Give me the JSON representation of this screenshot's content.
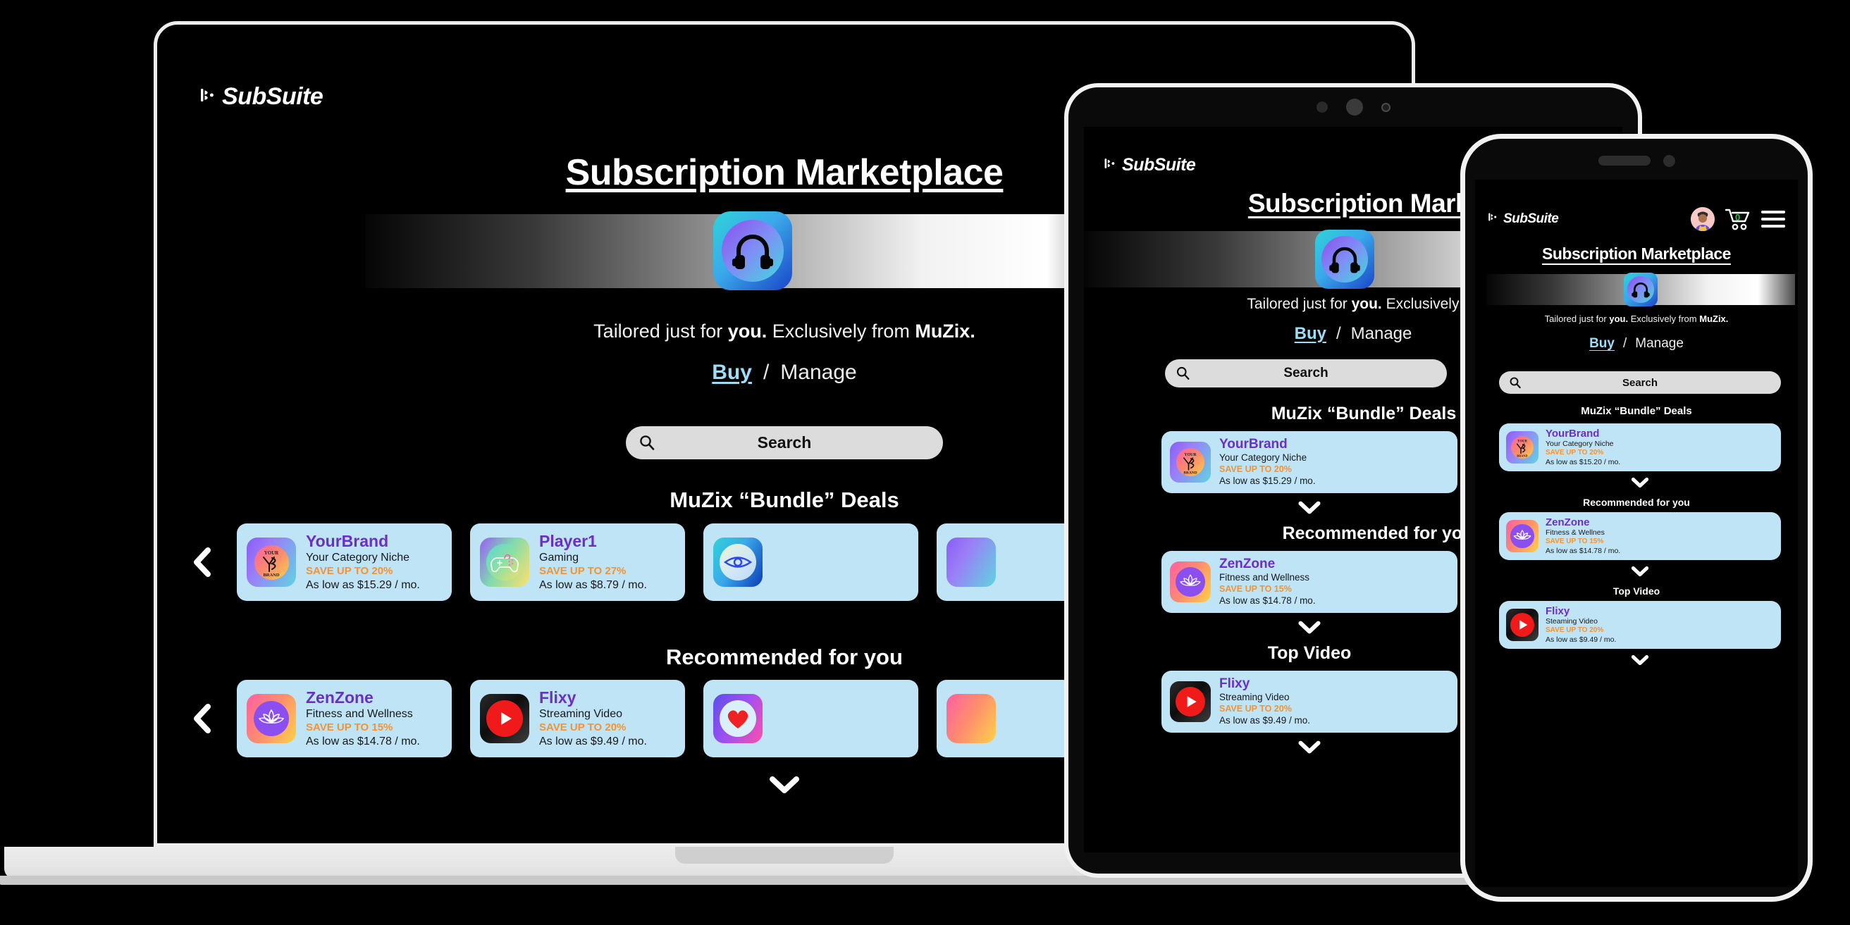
{
  "brand": {
    "name": "SubSuite",
    "tm": "™"
  },
  "page_title": "Subscription Marketplace",
  "tagline": {
    "prefix": "Tailored just for ",
    "you": "you.",
    "middle": " Exclusively from ",
    "vendor": "MuZix."
  },
  "nav": {
    "buy": "Buy",
    "separator": "/",
    "manage": "Manage"
  },
  "search": {
    "label": "Search",
    "icon": "search-icon"
  },
  "sections": {
    "bundle": "MuZix “Bundle” Deals",
    "recommended": "Recommended for you",
    "top_video": "Top Video"
  },
  "colors": {
    "card_bg": "#bfe4f5",
    "brand_purple": "#6b2fc4",
    "save_orange": "#f59331",
    "buy_blue": "#9fdcf5",
    "cart_green": "#2fc44a"
  },
  "cards": {
    "yourbrand": {
      "name": "YourBrand",
      "category": "Your Category Niche",
      "save": "SAVE UP TO 20%",
      "price": "As low as $15.29 / mo.",
      "icon": "yourbrand-logo-icon",
      "logo_top": "YOUR",
      "logo_mid": "YB",
      "logo_bottom": "BRAND"
    },
    "yourbrand_phone": {
      "name": "YourBrand",
      "category": "Your Category Niche",
      "save": "SAVE UP TO 20%",
      "price": "As low as $15.20 / mo."
    },
    "player1": {
      "name": "Player1",
      "category": "Gaming",
      "save": "SAVE UP TO 27%",
      "price": "As low as $8.79 / mo.",
      "icon": "gamepad-icon"
    },
    "zenzone": {
      "name": "ZenZone",
      "category": "Fitness and Wellness",
      "save": "SAVE UP TO 15%",
      "price": "As low as $14.78 / mo.",
      "icon": "lotus-icon"
    },
    "zenzone_phone": {
      "name": "ZenZone",
      "category": "Fitness & Wellnes",
      "save": "SAVE UP TO 15%",
      "price": "As low as $14.78 / mo."
    },
    "flixy": {
      "name": "Flixy",
      "category": "Streaming Video",
      "save": "SAVE UP TO 20%",
      "price": "As low as $9.49 / mo.",
      "icon": "play-button-icon"
    },
    "flixy_phone": {
      "name": "Flixy",
      "category": "Steaming Video",
      "save": "SAVE UP TO 20%",
      "price": "As low as $9.49 / mo."
    },
    "eye_partial": {
      "icon": "eye-icon"
    },
    "heart_partial": {
      "icon": "heart-icon"
    }
  },
  "phone_header": {
    "avatar": "user-avatar",
    "cart_icon": "shopping-cart-icon",
    "cart_count": "0",
    "menu_icon": "hamburger-menu-icon"
  },
  "controls": {
    "prev_arrow": "chevron-left-icon",
    "expand_arrow": "chevron-down-icon"
  },
  "devices": {
    "laptop": "laptop-mockup",
    "tablet": "tablet-mockup",
    "phone": "phone-mockup"
  }
}
